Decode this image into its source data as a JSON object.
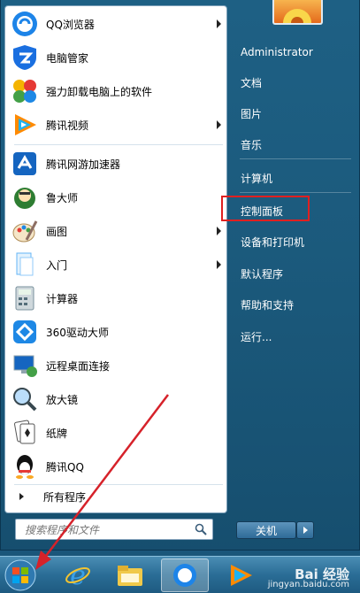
{
  "programs": [
    {
      "label": "QQ浏览器",
      "icon": "qq-browser-icon",
      "submenu": true
    },
    {
      "label": "电脑管家",
      "icon": "pc-manager-icon",
      "submenu": false
    },
    {
      "label": "强力卸载电脑上的软件",
      "icon": "uninstaller-icon",
      "submenu": false
    },
    {
      "label": "腾讯视频",
      "icon": "tencent-video-icon",
      "submenu": true
    },
    {
      "label": "腾讯网游加速器",
      "icon": "game-accelerator-icon",
      "submenu": false
    },
    {
      "label": "鲁大师",
      "icon": "ludashi-icon",
      "submenu": false
    },
    {
      "label": "画图",
      "icon": "paint-icon",
      "submenu": true
    },
    {
      "label": "入门",
      "icon": "getting-started-icon",
      "submenu": true
    },
    {
      "label": "计算器",
      "icon": "calculator-icon",
      "submenu": false
    },
    {
      "label": "360驱动大师",
      "icon": "driver-master-icon",
      "submenu": false
    },
    {
      "label": "远程桌面连接",
      "icon": "remote-desktop-icon",
      "submenu": false
    },
    {
      "label": "放大镜",
      "icon": "magnifier-icon",
      "submenu": false
    },
    {
      "label": "纸牌",
      "icon": "solitaire-icon",
      "submenu": false
    },
    {
      "label": "腾讯QQ",
      "icon": "qq-icon",
      "submenu": false
    }
  ],
  "all_programs": "所有程序",
  "search_placeholder": "搜索程序和文件",
  "right_items": [
    {
      "label": "Administrator"
    },
    {
      "label": "文档"
    },
    {
      "label": "图片"
    },
    {
      "label": "音乐"
    },
    {
      "label": "计算机"
    },
    {
      "label": "控制面板"
    },
    {
      "label": "设备和打印机"
    },
    {
      "label": "默认程序"
    },
    {
      "label": "帮助和支持"
    },
    {
      "label": "运行..."
    }
  ],
  "shutdown_label": "关机",
  "watermark": {
    "brand": "Bai 经验",
    "url": "jingyan.baidu.com"
  },
  "colors": {
    "highlight": "#e02020",
    "arrow": "#d6222a"
  }
}
